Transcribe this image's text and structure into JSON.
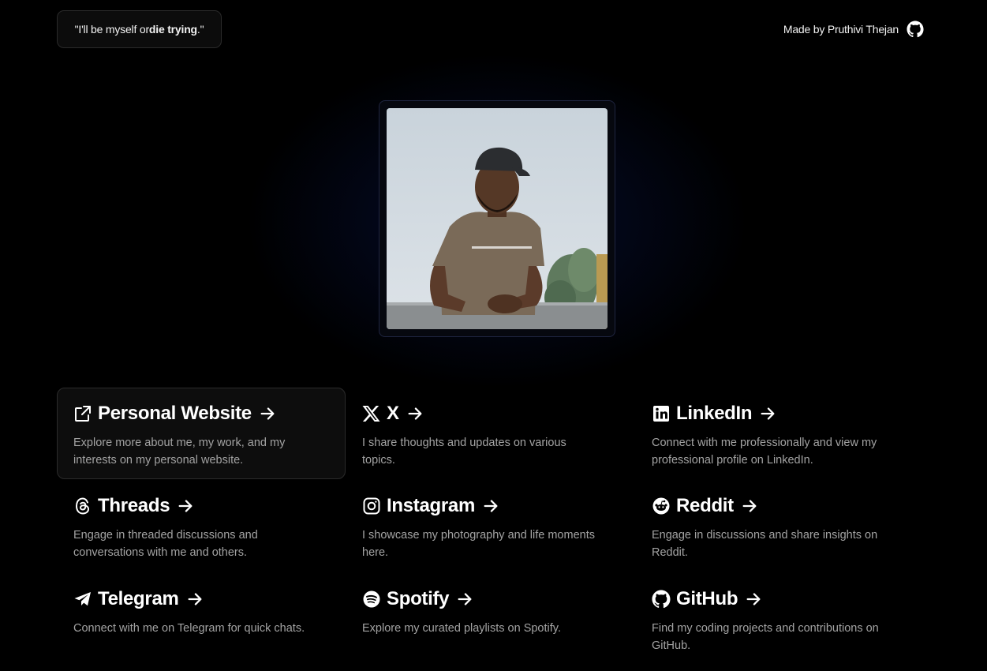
{
  "header": {
    "quote_prefix": "\"I'll be myself or ",
    "quote_bold": "die trying",
    "quote_suffix": ".\"",
    "made_by": "Made by Pruthivi Thejan",
    "made_by_icon": "github-icon"
  },
  "profile": {
    "photo_alt": "profile-photo"
  },
  "colors": {
    "background": "#000000",
    "glow": "#0a288c",
    "text": "#ffffff",
    "muted": "#a3a3a3",
    "card_border": "#2b2b2b"
  },
  "links": [
    {
      "title": "Personal Website",
      "icon": "external-link-icon",
      "description": "Explore more about me, my work, and my interests on my personal website."
    },
    {
      "title": "X",
      "icon": "x-icon",
      "description": "I share thoughts and updates on various topics."
    },
    {
      "title": "LinkedIn",
      "icon": "linkedin-icon",
      "description": "Connect with me professionally and view my professional profile on LinkedIn."
    },
    {
      "title": "Threads",
      "icon": "threads-icon",
      "description": "Engage in threaded discussions and conversations with me and others."
    },
    {
      "title": "Instagram",
      "icon": "instagram-icon",
      "description": "I showcase my photography and life moments here."
    },
    {
      "title": "Reddit",
      "icon": "reddit-icon",
      "description": "Engage in discussions and share insights on Reddit."
    },
    {
      "title": "Telegram",
      "icon": "telegram-icon",
      "description": "Connect with me on Telegram for quick chats."
    },
    {
      "title": "Spotify",
      "icon": "spotify-icon",
      "description": "Explore my curated playlists on Spotify."
    },
    {
      "title": "GitHub",
      "icon": "github-icon",
      "description": "Find my coding projects and contributions on GitHub."
    }
  ]
}
